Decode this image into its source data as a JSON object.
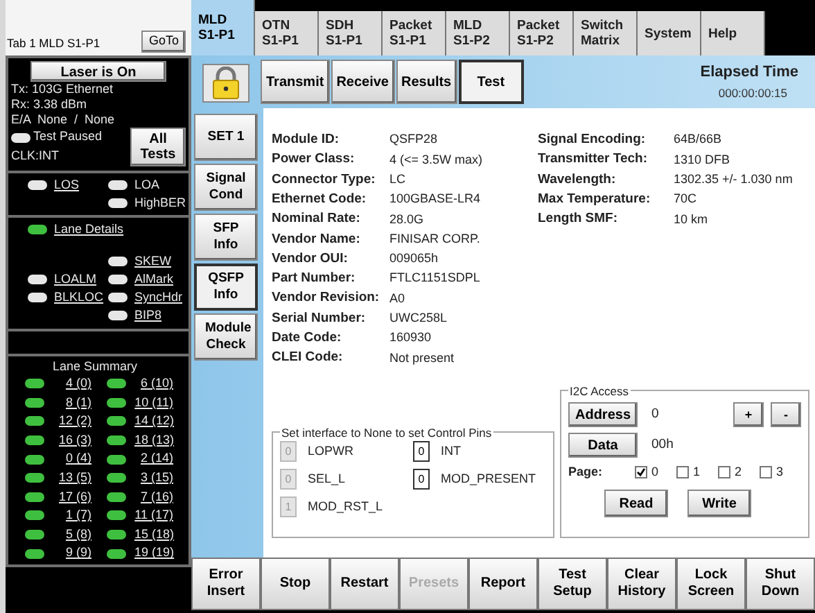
{
  "port_tab": {
    "label": "Tab 1 MLD S1-P1",
    "goto": "GoTo"
  },
  "status": {
    "laser": "Laser is On",
    "lines": [
      "Tx: 103G Ethernet",
      "Rx: 3.38 dBm",
      "E/A  None  /  None"
    ],
    "test_state": {
      "label": "Test Paused",
      "on": false
    },
    "clock": "CLK:INT",
    "all_tests": "All Tests"
  },
  "alarms": [
    {
      "left": {
        "label": "LOS",
        "on": false,
        "link": true
      },
      "right": {
        "label": "LOA",
        "on": false,
        "link": false
      }
    },
    {
      "right": {
        "label": "HighBER",
        "on": false,
        "link": false
      }
    }
  ],
  "lane_details": [
    {
      "left": {
        "label": "Lane Details",
        "on": true,
        "link": true
      }
    },
    {
      "right": {
        "label": "SKEW",
        "on": false,
        "link": true
      }
    },
    {
      "left": {
        "label": "LOALM",
        "on": false,
        "link": true
      },
      "right": {
        "label": "AlMark",
        "on": false,
        "link": true
      }
    },
    {
      "left": {
        "label": "BLKLOC",
        "on": false,
        "link": true
      },
      "right": {
        "label": "SyncHdr",
        "on": false,
        "link": true
      }
    },
    {
      "right": {
        "label": "BIP8",
        "on": false,
        "link": true
      }
    }
  ],
  "lane_summary": {
    "title": "Lane Summary",
    "lanes": [
      {
        "label": "4 (0)",
        "on": true
      },
      {
        "label": "6 (10)",
        "on": true
      },
      {
        "label": "8 (1)",
        "on": true
      },
      {
        "label": "10 (11)",
        "on": true
      },
      {
        "label": "12 (2)",
        "on": true
      },
      {
        "label": "14 (12)",
        "on": true
      },
      {
        "label": "16 (3)",
        "on": true
      },
      {
        "label": "18 (13)",
        "on": true
      },
      {
        "label": "0 (4)",
        "on": true
      },
      {
        "label": "2 (14)",
        "on": true
      },
      {
        "label": "13 (5)",
        "on": true
      },
      {
        "label": "3 (15)",
        "on": true
      },
      {
        "label": "17 (6)",
        "on": true
      },
      {
        "label": "7 (16)",
        "on": true
      },
      {
        "label": "1 (7)",
        "on": true
      },
      {
        "label": "11 (17)",
        "on": true
      },
      {
        "label": "5 (8)",
        "on": true
      },
      {
        "label": "15 (18)",
        "on": true
      },
      {
        "label": "9 (9)",
        "on": true
      },
      {
        "label": "19 (19)",
        "on": true
      }
    ]
  },
  "top_tabs": [
    {
      "label": "MLD S1-P1",
      "selected": true
    },
    {
      "label": "OTN S1-P1",
      "selected": false
    },
    {
      "label": "SDH S1-P1",
      "selected": false
    },
    {
      "label": "Packet S1-P1",
      "selected": false
    },
    {
      "label": "MLD S1-P2",
      "selected": false
    },
    {
      "label": "Packet S1-P2",
      "selected": false
    },
    {
      "label": "Switch Matrix",
      "selected": false
    },
    {
      "label": "System",
      "selected": false
    },
    {
      "label": "Help",
      "selected": false
    }
  ],
  "side_tabs": [
    {
      "label": "SET 1",
      "selected": false
    },
    {
      "label": "Signal Cond",
      "selected": false
    },
    {
      "label": "SFP Info",
      "selected": false
    },
    {
      "label": "QSFP Info",
      "selected": true
    },
    {
      "label": "Module Check",
      "selected": false
    }
  ],
  "sub_tabs": [
    {
      "label": "Transmit",
      "selected": false
    },
    {
      "label": "Receive",
      "selected": false
    },
    {
      "label": "Results",
      "selected": false
    },
    {
      "label": "Test",
      "selected": true
    }
  ],
  "elapsed": {
    "label": "Elapsed Time",
    "value": "000:00:00:15"
  },
  "module_info": [
    [
      {
        "label": "Module ID:",
        "value": "QSFP28"
      },
      {
        "label": "Power Class:",
        "value": "4 (<= 3.5W max)"
      },
      {
        "label": "Connector Type:",
        "value": "LC"
      },
      {
        "label": "Ethernet Code:",
        "value": "100GBASE-LR4"
      },
      {
        "label": "Nominal Rate:",
        "value": "28.0G"
      },
      {
        "label": "Vendor Name:",
        "value": "FINISAR CORP."
      },
      {
        "label": "Vendor OUI:",
        "value": "009065h"
      },
      {
        "label": "Part Number:",
        "value": "FTLC1151SDPL"
      },
      {
        "label": "Vendor Revision:",
        "value": "A0"
      },
      {
        "label": "Serial Number:",
        "value": "UWC258L"
      },
      {
        "label": "Date Code:",
        "value": "160930"
      },
      {
        "label": "CLEI Code:",
        "value": "Not present"
      }
    ],
    [
      {
        "label": "Signal Encoding:",
        "value": "64B/66B"
      },
      {
        "label": "Transmitter Tech:",
        "value": "1310 DFB"
      },
      {
        "label": "Wavelength:",
        "value": "1302.35 +/- 1.030 nm"
      },
      {
        "label": "Max Temperature:",
        "value": "70C"
      },
      {
        "label": "Length SMF:",
        "value": "10 km"
      }
    ]
  ],
  "control_pins": {
    "title": "Set interface to None to set Control Pins",
    "pins": [
      {
        "label": "LOPWR",
        "value": "0",
        "disabled": true
      },
      {
        "label": "INT",
        "value": "0",
        "disabled": false
      },
      {
        "label": "SEL_L",
        "value": "0",
        "disabled": true
      },
      {
        "label": "MOD_PRESENT",
        "value": "0",
        "disabled": false
      },
      {
        "label": "MOD_RST_L",
        "value": "1",
        "disabled": true
      }
    ]
  },
  "i2c": {
    "title": "I2C Access",
    "address_button": "Address",
    "address": "0",
    "plus": "+",
    "minus": "-",
    "data_button": "Data",
    "data": "00h",
    "page_label": "Page:",
    "pages": [
      {
        "label": "0",
        "checked": true
      },
      {
        "label": "1",
        "checked": false
      },
      {
        "label": "2",
        "checked": false
      },
      {
        "label": "3",
        "checked": false
      }
    ],
    "read": "Read",
    "write": "Write"
  },
  "bottom_buttons": [
    {
      "label": "Error Insert",
      "disabled": false
    },
    {
      "label": "Stop",
      "disabled": false
    },
    {
      "label": "Restart",
      "disabled": false
    },
    {
      "label": "Presets",
      "disabled": true
    },
    {
      "label": "Report",
      "disabled": false
    },
    {
      "label": "Test Setup",
      "disabled": false
    },
    {
      "label": "Clear History",
      "disabled": false
    },
    {
      "label": "Lock Screen",
      "disabled": false
    },
    {
      "label": "Shut Down",
      "disabled": false
    }
  ]
}
